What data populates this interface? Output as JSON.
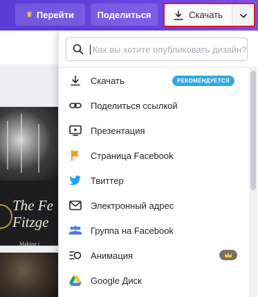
{
  "topbar": {
    "go_label": "Перейти",
    "share_label": "Поделиться",
    "download_label": "Скачать",
    "gradient_color": "#6a44e2",
    "highlight_color": "#e1162b"
  },
  "design": {
    "title_line1": "The Fe",
    "title_line2": "Fitzge",
    "subtitle": "Making r"
  },
  "dropdown": {
    "search_placeholder": "Как вы хотите опубликовать дизайн?",
    "items": [
      {
        "label": "Скачать",
        "icon": "download-icon",
        "badge": "РЕКОМЕНДУЕТСЯ"
      },
      {
        "label": "Поделиться ссылкой",
        "icon": "link-icon"
      },
      {
        "label": "Презентация",
        "icon": "presentation-icon"
      },
      {
        "label": "Страница Facebook",
        "icon": "flag-icon"
      },
      {
        "label": "Твиттер",
        "icon": "twitter-icon"
      },
      {
        "label": "Электронный адрес",
        "icon": "email-icon"
      },
      {
        "label": "Группа на Facebook",
        "icon": "group-icon"
      },
      {
        "label": "Анимация",
        "icon": "animation-icon",
        "premium": true
      },
      {
        "label": "Google Диск",
        "icon": "google-drive-icon"
      }
    ],
    "colors": {
      "badge": "#31a8e0",
      "flag": "#f49b24",
      "twitter": "#1da1f2",
      "group": "#4a7bd8"
    }
  }
}
